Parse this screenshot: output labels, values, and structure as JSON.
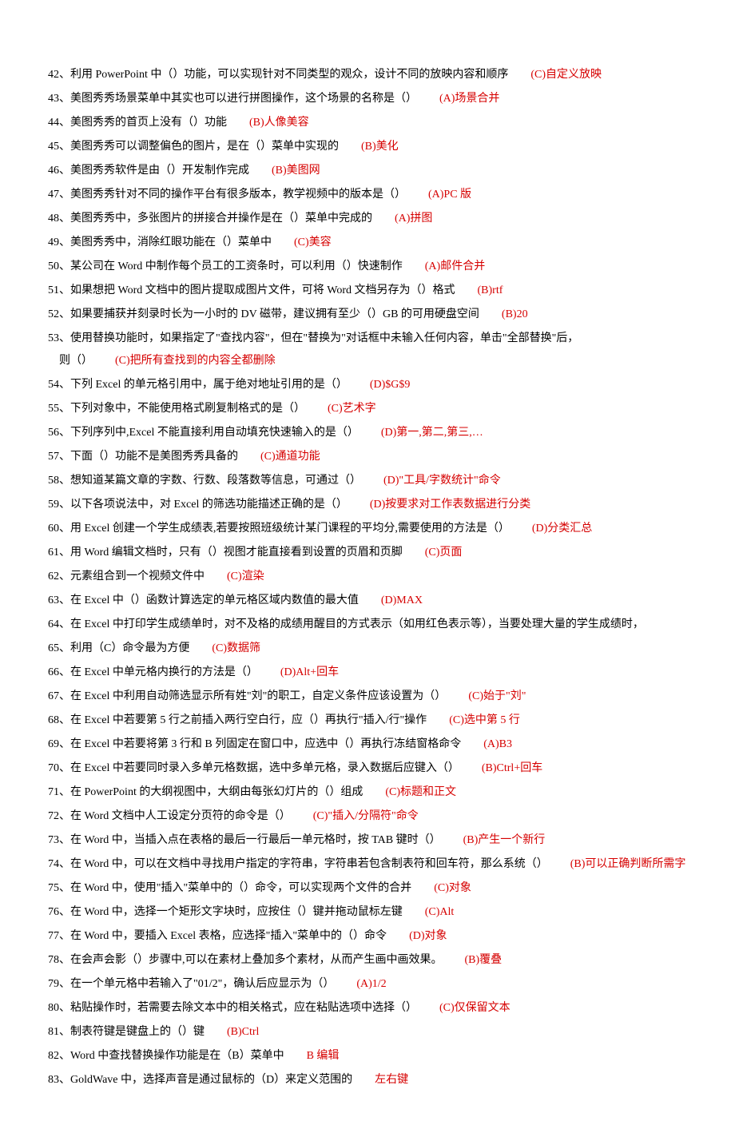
{
  "items": [
    {
      "num": "42、",
      "text": "利用 PowerPoint 中（）功能，可以实现针对不同类型的观众，设计不同的放映内容和顺序",
      "ans": "(C)自定义放映"
    },
    {
      "num": "43、",
      "text": "美图秀秀场景菜单中其实也可以进行拼图操作，这个场景的名称是（）",
      "ans": "(A)场景合并"
    },
    {
      "num": "44、",
      "text": "美图秀秀的首页上没有（）功能",
      "ans": "(B)人像美容"
    },
    {
      "num": "45、",
      "text": "美图秀秀可以调整偏色的图片，是在（）菜单中实现的",
      "ans": "(B)美化"
    },
    {
      "num": "46、",
      "text": "美图秀秀软件是由（）开发制作完成",
      "ans": "(B)美图网"
    },
    {
      "num": "47、",
      "text": "美图秀秀针对不同的操作平台有很多版本，教学视频中的版本是（）",
      "ans": "(A)PC 版"
    },
    {
      "num": "48、",
      "text": "美图秀秀中，多张图片的拼接合并操作是在（）菜单中完成的",
      "ans": "(A)拼图"
    },
    {
      "num": "49、",
      "text": "美图秀秀中，消除红眼功能在（）菜单中",
      "ans": "(C)美容"
    },
    {
      "num": "50、",
      "text": "某公司在 Word 中制作每个员工的工资条时，可以利用（）快速制作",
      "ans": "(A)邮件合并"
    },
    {
      "num": "51、",
      "text": "如果想把 Word 文档中的图片提取成图片文件，可将 Word 文档另存为（）格式",
      "ans": "(B)rtf"
    },
    {
      "num": "52、",
      "text": "如果要捕获并刻录时长为一小时的 DV 磁带，建议拥有至少（）GB 的可用硬盘空间",
      "ans": "(B)20"
    },
    {
      "num": "53、",
      "text": "使用替换功能时，如果指定了\"查找内容\"，但在\"替换为\"对话框中未输入任何内容，单击\"全部替换\"后，",
      "cont": "则（）",
      "ans": "(C)把所有查找到的内容全都删除"
    },
    {
      "num": "54、",
      "text": "下列 Excel 的单元格引用中，属于绝对地址引用的是（）",
      "ans": "(D)$G$9"
    },
    {
      "num": "55、",
      "text": "下列对象中，不能使用格式刷复制格式的是（）",
      "ans": "(C)艺术字"
    },
    {
      "num": "56、",
      "text": "下列序列中,Excel 不能直接利用自动填充快速输入的是（）",
      "ans": "(D)第一,第二,第三,…"
    },
    {
      "num": "57、",
      "text": "下面（）功能不是美图秀秀具备的",
      "ans": "(C)通道功能"
    },
    {
      "num": "58、",
      "text": "想知道某篇文章的字数、行数、段落数等信息，可通过（）",
      "ans": "(D)\"工具/字数统计\"命令"
    },
    {
      "num": "59、",
      "text": "以下各项说法中，对 Excel 的筛选功能描述正确的是（）",
      "ans": "(D)按要求对工作表数据进行分类"
    },
    {
      "num": "60、",
      "text": "用 Excel 创建一个学生成绩表,若要按照班级统计某门课程的平均分,需要使用的方法是（）",
      "ans": "(D)分类汇总"
    },
    {
      "num": "61、",
      "text": "用 Word 编辑文档时，只有（）视图才能直接看到设置的页眉和页脚",
      "ans": "(C)页面"
    },
    {
      "num": "62、",
      "text": "元素组合到一个视频文件中",
      "ans": "(C)渲染"
    },
    {
      "num": "63、",
      "text": "在 Excel 中（）函数计算选定的单元格区域内数值的最大值",
      "ans": "(D)MAX"
    },
    {
      "num": "64、",
      "text": "在 Excel 中打印学生成绩单时，对不及格的成绩用醒目的方式表示（如用红色表示等），当要处理大量的学生成绩时，",
      "ans": ""
    },
    {
      "num": "65、",
      "text": "利用（C）命令最为方便",
      "ans": "(C)数据筛"
    },
    {
      "num": "66、",
      "text": "在 Excel 中单元格内换行的方法是（）",
      "ans": "(D)Alt+回车"
    },
    {
      "num": "67、",
      "text": "在 Excel 中利用自动筛选显示所有姓\"刘\"的职工，自定义条件应该设置为（）",
      "ans": "(C)始于\"刘\""
    },
    {
      "num": "68、",
      "text": "在 Excel 中若要第 5 行之前插入两行空白行，应（）再执行\"插入/行\"操作",
      "ans": "(C)选中第 5 行"
    },
    {
      "num": "69、",
      "text": "在 Excel 中若要将第 3 行和 B 列固定在窗口中，应选中（）再执行冻结窗格命令",
      "ans": "(A)B3"
    },
    {
      "num": "70、",
      "text": "在 Excel 中若要同时录入多单元格数据，选中多单元格，录入数据后应键入（）",
      "ans": "(B)Ctrl+回车"
    },
    {
      "num": "71、",
      "text": "在 PowerPoint 的大纲视图中，大纲由每张幻灯片的（）组成",
      "ans": "(C)标题和正文"
    },
    {
      "num": "72、",
      "text": "在 Word 文档中人工设定分页符的命令是（）",
      "ans": "(C)\"插入/分隔符\"命令"
    },
    {
      "num": "73、",
      "text": "在 Word 中，当插入点在表格的最后一行最后一单元格时，按 TAB 键时（）",
      "ans": "(B)产生一个新行"
    },
    {
      "num": "74、",
      "text": "在 Word 中，可以在文档中寻找用户指定的字符串，字符串若包含制表符和回车符，那么系统（）",
      "ans": "(B)可以正确判断所需字"
    },
    {
      "num": "75、",
      "text": "在 Word 中，使用\"插入\"菜单中的（）命令，可以实现两个文件的合并",
      "ans": "(C)对象"
    },
    {
      "num": "76、",
      "text": "在 Word 中，选择一个矩形文字块时，应按住（）键并拖动鼠标左键",
      "ans": "(C)Alt"
    },
    {
      "num": "77、",
      "text": "在 Word 中，要插入 Excel 表格，应选择\"插入\"菜单中的（）命令",
      "ans": "(D)对象"
    },
    {
      "num": "78、",
      "text": "在会声会影（）步骤中,可以在素材上叠加多个素材，从而产生画中画效果。",
      "ans": "(B)覆叠"
    },
    {
      "num": "79、",
      "text": "在一个单元格中若输入了\"01/2\"，确认后应显示为（）",
      "ans": "(A)1/2"
    },
    {
      "num": "80、",
      "text": "粘贴操作时，若需要去除文本中的相关格式，应在粘贴选项中选择（）",
      "ans": "(C)仅保留文本"
    },
    {
      "num": "81、",
      "text": "制表符键是键盘上的（）键",
      "ans": "(B)Ctrl"
    },
    {
      "num": "82、",
      "text": "Word 中查找替换操作功能是在（B）菜单中",
      "ans": "B 编辑"
    },
    {
      "num": "83、",
      "text": "GoldWave 中，选择声音是通过鼠标的（D）来定义范围的",
      "ans": "左右键"
    }
  ]
}
